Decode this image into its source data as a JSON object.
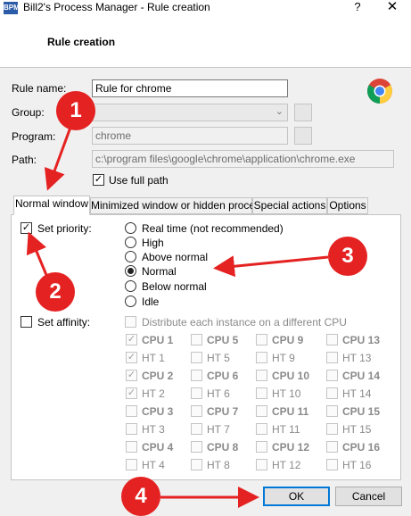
{
  "window": {
    "title": "Bill2's Process Manager - Rule creation",
    "help": "?",
    "close": "✕",
    "app_icon": "BPM"
  },
  "header": {
    "title": "Rule creation"
  },
  "form": {
    "rule_name_label": "Rule name:",
    "rule_name_value": "Rule for chrome",
    "group_label": "Group:",
    "group_value": "",
    "program_label": "Program:",
    "program_value": "chrome",
    "path_label": "Path:",
    "path_value": "c:\\program files\\google\\chrome\\application\\chrome.exe",
    "use_full_path_label": "Use full path",
    "use_full_path_checked": true
  },
  "tabs": [
    "Normal window",
    "Minimized window or hidden process",
    "Special actions",
    "Options"
  ],
  "priority": {
    "label": "Set priority:",
    "checked": true,
    "options": [
      "Real time (not recommended)",
      "High",
      "Above normal",
      "Normal",
      "Below normal",
      "Idle"
    ],
    "selected": "Normal"
  },
  "affinity": {
    "label": "Set affinity:",
    "checked": false,
    "distribute_label": "Distribute each instance on a different CPU",
    "grid": [
      [
        {
          "t": "CPU 1",
          "b": true,
          "c": true
        },
        {
          "t": "CPU 5",
          "b": true,
          "c": false
        },
        {
          "t": "CPU 9",
          "b": true,
          "c": false
        },
        {
          "t": "CPU 13",
          "b": true,
          "c": false
        }
      ],
      [
        {
          "t": "HT 1",
          "b": false,
          "c": true
        },
        {
          "t": "HT 5",
          "b": false,
          "c": false
        },
        {
          "t": "HT 9",
          "b": false,
          "c": false
        },
        {
          "t": "HT 13",
          "b": false,
          "c": false
        }
      ],
      [
        {
          "t": "CPU 2",
          "b": true,
          "c": true
        },
        {
          "t": "CPU 6",
          "b": true,
          "c": false
        },
        {
          "t": "CPU 10",
          "b": true,
          "c": false
        },
        {
          "t": "CPU 14",
          "b": true,
          "c": false
        }
      ],
      [
        {
          "t": "HT 2",
          "b": false,
          "c": true
        },
        {
          "t": "HT 6",
          "b": false,
          "c": false
        },
        {
          "t": "HT 10",
          "b": false,
          "c": false
        },
        {
          "t": "HT 14",
          "b": false,
          "c": false
        }
      ],
      [
        {
          "t": "CPU 3",
          "b": true,
          "c": false
        },
        {
          "t": "CPU 7",
          "b": true,
          "c": false
        },
        {
          "t": "CPU 11",
          "b": true,
          "c": false
        },
        {
          "t": "CPU 15",
          "b": true,
          "c": false
        }
      ],
      [
        {
          "t": "HT 3",
          "b": false,
          "c": false
        },
        {
          "t": "HT 7",
          "b": false,
          "c": false
        },
        {
          "t": "HT 11",
          "b": false,
          "c": false
        },
        {
          "t": "HT 15",
          "b": false,
          "c": false
        }
      ],
      [
        {
          "t": "CPU 4",
          "b": true,
          "c": false
        },
        {
          "t": "CPU 8",
          "b": true,
          "c": false
        },
        {
          "t": "CPU 12",
          "b": true,
          "c": false
        },
        {
          "t": "CPU 16",
          "b": true,
          "c": false
        }
      ],
      [
        {
          "t": "HT 4",
          "b": false,
          "c": false
        },
        {
          "t": "HT 8",
          "b": false,
          "c": false
        },
        {
          "t": "HT 12",
          "b": false,
          "c": false
        },
        {
          "t": "HT 16",
          "b": false,
          "c": false
        }
      ]
    ]
  },
  "buttons": {
    "ok": "OK",
    "cancel": "Cancel"
  },
  "annotations": [
    "1",
    "2",
    "3",
    "4"
  ],
  "colors": {
    "annotation_red": "#e52222",
    "focus_blue": "#0078d7"
  }
}
